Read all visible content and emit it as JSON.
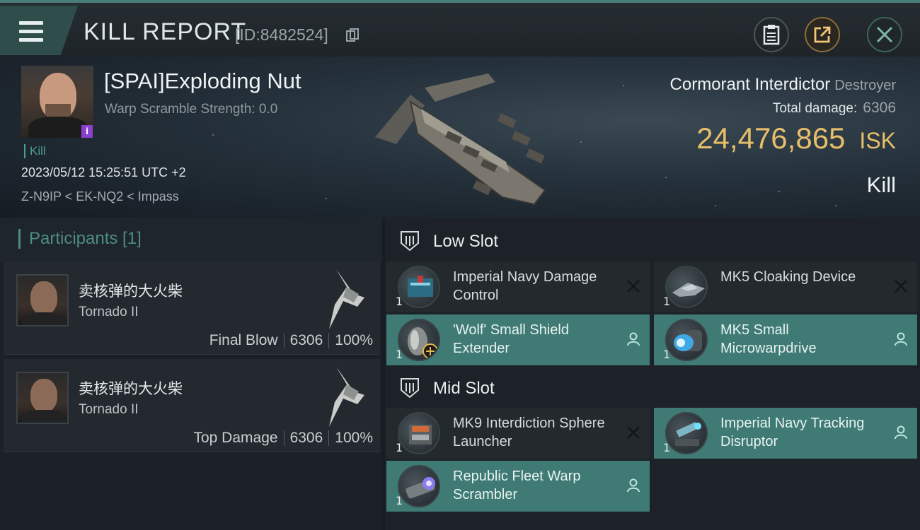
{
  "header": {
    "title": "KILL REPORT",
    "report_id": "[ID:8482524]"
  },
  "victim": {
    "name": "[SPAI]Exploding Nut",
    "warp_scramble": "Warp Scramble Strength: 0.0",
    "tag": "Kill",
    "timestamp": "2023/05/12 15:25:51 UTC +2",
    "location": "Z-N9IP < EK-NQ2 < Impass",
    "ship_name": "Cormorant Interdictor",
    "ship_class": "Destroyer",
    "total_damage_label": "Total damage:",
    "total_damage_value": "6306",
    "isk_value": "24,476,865",
    "isk_unit": "ISK",
    "result": "Kill"
  },
  "participants": {
    "title": "Participants [1]",
    "items": [
      {
        "name": "卖核弹的大火柴",
        "ship": "Tornado II",
        "role": "Final Blow",
        "damage": "6306",
        "percent": "100%"
      },
      {
        "name": "卖核弹的大火柴",
        "ship": "Tornado II",
        "role": "Top Damage",
        "damage": "6306",
        "percent": "100%"
      }
    ]
  },
  "fitting": {
    "low_slot": {
      "title": "Low Slot",
      "modules": [
        {
          "name": "Imperial Navy Damage Control",
          "qty": "1",
          "state": "destroyed",
          "icon": "damage-control-icon"
        },
        {
          "name": "MK5 Cloaking Device",
          "qty": "1",
          "state": "destroyed",
          "icon": "cloaking-device-icon"
        },
        {
          "name": "'Wolf' Small Shield Extender",
          "qty": "1",
          "state": "dropped",
          "icon": "shield-extender-icon"
        },
        {
          "name": "MK5 Small Microwarpdrive",
          "qty": "1",
          "state": "dropped",
          "icon": "microwarpdrive-icon"
        }
      ]
    },
    "mid_slot": {
      "title": "Mid Slot",
      "modules": [
        {
          "name": "MK9 Interdiction Sphere Launcher",
          "qty": "1",
          "state": "destroyed",
          "icon": "interdiction-launcher-icon"
        },
        {
          "name": "Imperial Navy Tracking Disruptor",
          "qty": "1",
          "state": "dropped",
          "icon": "tracking-disruptor-icon"
        },
        {
          "name": "Republic Fleet Warp Scrambler",
          "qty": "1",
          "state": "dropped",
          "icon": "warp-scrambler-icon"
        }
      ]
    }
  },
  "colors": {
    "accent": "#3f7a74",
    "isk": "#e7bf6a",
    "purple_badge": "#8a3fd1"
  }
}
